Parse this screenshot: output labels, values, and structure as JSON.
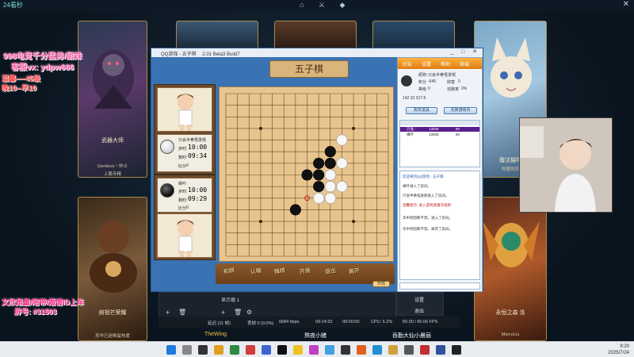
{
  "stream": {
    "logo_text": "24看秒",
    "top_icons": "⌂ ⚔ ◆",
    "left_overlay": {
      "line1": "998电竞千分猛男/甜妹",
      "line2": "客服vx: ydpw666",
      "line3": "温馨----45级",
      "line4": "晚10--早10",
      "line5": "文欣是童/陪带/婚请ID上车",
      "line6": "屏号: #31503"
    }
  },
  "cards": {
    "top_left": {
      "name": "武器大师",
      "sub": "Gentless丶帅士",
      "sub2": "上路专精"
    },
    "bottom_left": {
      "name": "纳祖芒荣耀",
      "sub": "芳华已逝唯留热爱"
    },
    "top_right": {
      "name": "魔法猫咪",
      "sub": "阿蒙的莎"
    },
    "bottom_right": {
      "name": "永恒之森 洛",
      "sub": "MarcoLiu"
    },
    "bottom_center_label": "TheWing",
    "bottom_mid_label": "熬夜小猪",
    "bottom_right_label": "吞勤大仙小晨丽"
  },
  "game": {
    "window_title": "QQ游戏 - 五子棋",
    "version": "2.01 Beta3 Build7",
    "header": "五子棋",
    "player_top": {
      "name": "只会半拳怪发呢",
      "step_label": "步时:",
      "step_time": "10:00",
      "total_label": "剩时:",
      "total_time": "09:34",
      "score_label": "比分",
      "score": "0"
    },
    "player_bottom": {
      "name": "缘叶",
      "step_label": "步时:",
      "step_time": "10:00",
      "total_label": "剩时:",
      "total_time": "09:29",
      "score_label": "比分",
      "score": "0"
    },
    "wood_buttons": [
      "和棋",
      "认输",
      "悔棋",
      "开局",
      "退出",
      "离开"
    ],
    "fast_btn": "开局",
    "stones": {
      "black": [
        [
          9,
          5
        ],
        [
          8,
          6
        ],
        [
          9,
          6
        ],
        [
          8,
          7
        ],
        [
          7,
          7
        ],
        [
          8,
          8
        ],
        [
          6,
          10
        ]
      ],
      "white": [
        [
          10,
          4
        ],
        [
          9,
          7
        ],
        [
          10,
          6
        ],
        [
          10,
          8
        ],
        [
          9,
          8
        ],
        [
          8,
          9
        ],
        [
          9,
          9
        ]
      ],
      "last_move": [
        7,
        9
      ],
      "dots": [
        [
          3,
          3
        ],
        [
          11,
          3
        ],
        [
          7,
          7
        ],
        [
          3,
          11
        ],
        [
          11,
          11
        ]
      ]
    },
    "right_panel": {
      "tabs": [
        "好友",
        "设置",
        "帮助",
        "商城"
      ],
      "user_label": "昵称:",
      "user_name": "只会半拳怪发呢",
      "score_label": "积分",
      "score_val": "-645",
      "rank_label": "财富",
      "rank_val": "0",
      "level_label": "等级",
      "level_val": "0",
      "win_label": "逃跑率",
      "win_val": "0%",
      "stats": "142  23  317  8",
      "btn_left": "购买道具",
      "btn_right": "兑换游戏币",
      "players": [
        {
          "name": "只会..",
          "score": "13025",
          "extra": "60"
        },
        {
          "name": "缘叶",
          "score": "13406",
          "extra": "60"
        }
      ],
      "chat": [
        {
          "text": "欢迎来到QQ游戏 - 五子棋",
          "color": "#2b61b5"
        },
        {
          "text": "缘叶进入了房间。",
          "color": "#333"
        },
        {
          "text": "只会半拳怪发呢进入了房间。",
          "color": "#333"
        },
        {
          "text": "温馨提示: 进入游戏请遵守规则",
          "color": "#c02020"
        },
        {
          "text": "华中到因断不禁。进入了房间。",
          "color": "#333"
        },
        {
          "text": "华中到因断不禁。离开了房间。",
          "color": "#333"
        }
      ]
    }
  },
  "controls": {
    "display_capture": "显示器 1",
    "right_btn1": "设置",
    "right_btn2": "退出",
    "delay": "延迟 (11 帧)",
    "frames": "丢帧 0 (0.0%)",
    "bitrate": "6684 kbps",
    "time": "09:24:32",
    "time2": "00:00:00",
    "cpu": "CPU: 5.2%",
    "fps": "60.00 / 60.00 FPS"
  },
  "taskbar": {
    "time": "9:20",
    "date": "2025/7/24"
  }
}
